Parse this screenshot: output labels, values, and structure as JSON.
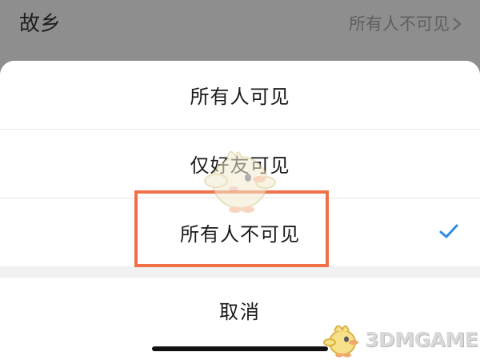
{
  "background_row": {
    "label": "故乡",
    "value": "所有人不可见",
    "chevron_icon": "chevron-right-icon"
  },
  "sheet": {
    "options": [
      {
        "label": "所有人可见",
        "selected": false
      },
      {
        "label": "仅好友可见",
        "selected": false
      },
      {
        "label": "所有人不可见",
        "selected": true
      }
    ],
    "check_icon": "checkmark-icon",
    "cancel_label": "取消"
  },
  "watermark": {
    "text": "3DMGAME"
  },
  "colors": {
    "accent": "#2b8de3",
    "highlight_border": "#f0704a",
    "backdrop": "#8e8e8e"
  }
}
